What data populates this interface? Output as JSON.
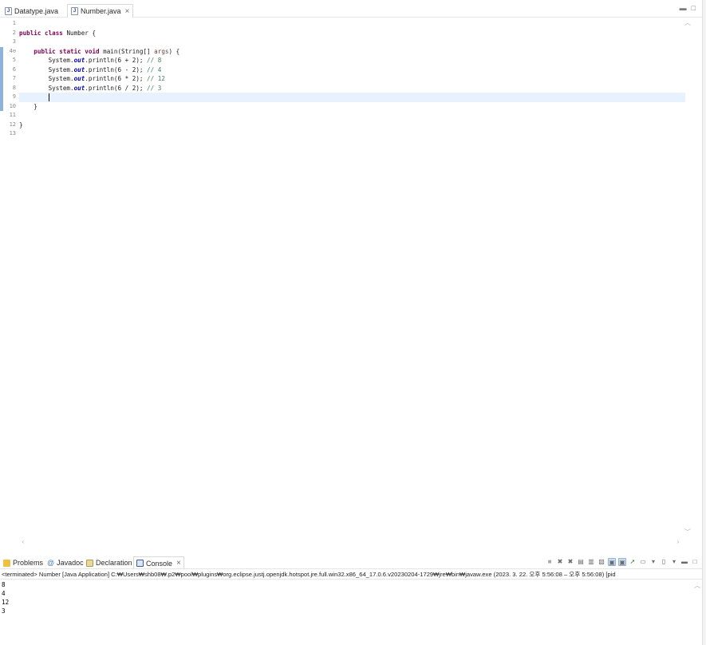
{
  "editor_tabs": [
    {
      "label": "Datatype.java",
      "active": false,
      "icon": "java-file-icon"
    },
    {
      "label": "Number.java",
      "active": true,
      "icon": "java-file-icon",
      "close": "×"
    }
  ],
  "view_controls": {
    "minimize": "▬",
    "maximize": "□"
  },
  "gutter": [
    "1",
    "2",
    "3",
    "4⊖",
    "5",
    "6",
    "7",
    "8",
    "9",
    "10",
    "11",
    "12",
    "13"
  ],
  "code": {
    "line2": [
      "public class",
      " Number {"
    ],
    "line4": [
      "public static void",
      " main(String[] ",
      "args",
      ") {"
    ],
    "line5": [
      "System.",
      "out",
      ".println(6 + 2); ",
      "// 8"
    ],
    "line6": [
      "System.",
      "out",
      ".println(6 - 2); ",
      "// 4"
    ],
    "line7": [
      "System.",
      "out",
      ".println(6 * 2); ",
      "// 12"
    ],
    "line8": [
      "System.",
      "out",
      ".println(6 / 2); ",
      "// 3"
    ],
    "line10": "    }",
    "line12": "}"
  },
  "console_tabs": [
    {
      "label": "Problems",
      "icon": "problems-icon"
    },
    {
      "label": "Javadoc",
      "icon": "javadoc-icon"
    },
    {
      "label": "Declaration",
      "icon": "declaration-icon"
    },
    {
      "label": "Console",
      "icon": "console-icon",
      "active": true,
      "close": "×"
    }
  ],
  "console": {
    "header": "<terminated> Number [Java Application] C:₩Users₩shb08₩.p2₩pool₩plugins₩org.eclipse.justj.openjdk.hotspot.jre.full.win32.x86_64_17.0.6.v20230204-1729₩jre₩bin₩javaw.exe  (2023. 3. 22. 오후 5:56:08 – 오후 5:56:08) [pid",
    "output": [
      "8",
      "4",
      "12",
      "3"
    ]
  },
  "colors": {
    "keyword": "#7f0055",
    "field": "#0000c0",
    "comment": "#3f7f5f",
    "current_line": "#e8f2fe",
    "change_marker": "#8fb2d9"
  }
}
